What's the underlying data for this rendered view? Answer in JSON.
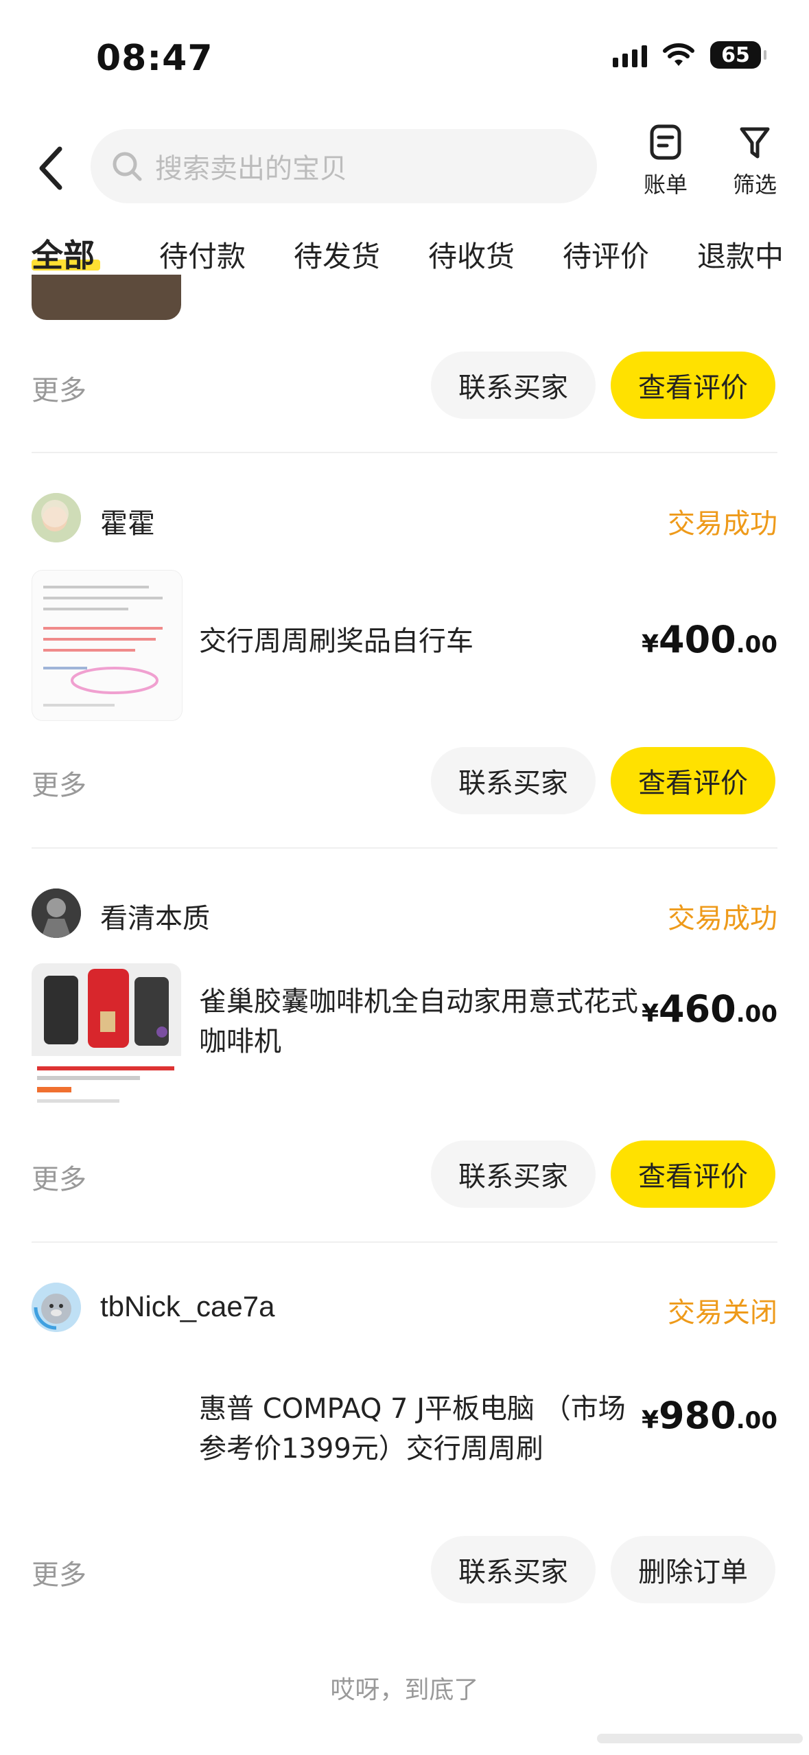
{
  "status_bar": {
    "time": "08:47",
    "battery": "65"
  },
  "header": {
    "search_placeholder": "搜索卖出的宝贝",
    "bill_label": "账单",
    "filter_label": "筛选"
  },
  "tabs": [
    "全部",
    "待付款",
    "待发货",
    "待收货",
    "待评价",
    "退款中"
  ],
  "colors": {
    "accent_yellow": "#ffe100",
    "status_orange": "#ee9a1a"
  },
  "orders": [
    {
      "more_label": "更多",
      "contact_label": "联系买家",
      "action_label": "查看评价"
    },
    {
      "seller": "霍霍",
      "status": "交易成功",
      "title": "交行周周刷奖品自行车",
      "price_symbol": "¥",
      "price_int": "400",
      "price_dec": ".00",
      "more_label": "更多",
      "contact_label": "联系买家",
      "action_label": "查看评价"
    },
    {
      "seller": "看清本质",
      "status": "交易成功",
      "title": "雀巢胶囊咖啡机全自动家用意式花式咖啡机",
      "price_symbol": "¥",
      "price_int": "460",
      "price_dec": ".00",
      "more_label": "更多",
      "contact_label": "联系买家",
      "action_label": "查看评价"
    },
    {
      "seller": "tbNick_cae7a",
      "status": "交易关闭",
      "title": "惠普 COMPAQ 7 J平板电脑 （市场参考价1399元）交行周周刷",
      "price_symbol": "¥",
      "price_int": "980",
      "price_dec": ".00",
      "more_label": "更多",
      "contact_label": "联系买家",
      "action_label": "删除订单"
    }
  ],
  "end_text": "哎呀，到底了"
}
